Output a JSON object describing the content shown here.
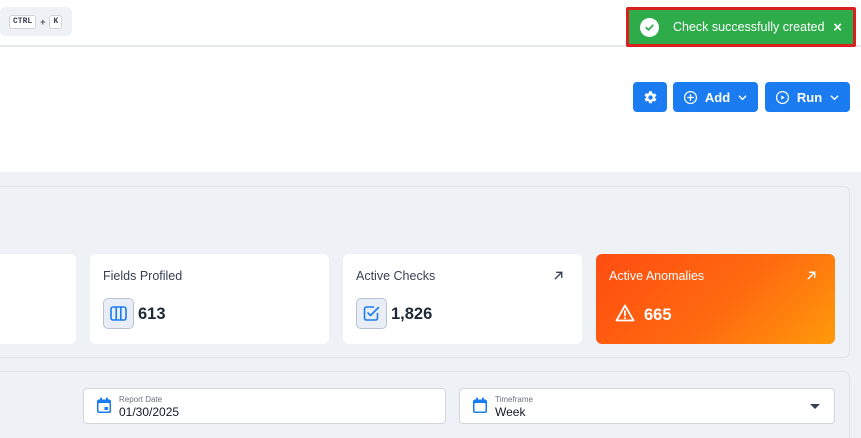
{
  "topbar": {
    "shortcut": {
      "key1": "CTRL",
      "plus": "+",
      "key2": "K"
    }
  },
  "toolbar": {
    "settings_icon": "gear-icon",
    "add_label": "Add",
    "run_label": "Run"
  },
  "summary": {
    "cards": [
      {
        "title": "Fields Profiled",
        "value": "613",
        "icon": "columns-icon"
      },
      {
        "title": "Active Checks",
        "value": "1,826",
        "icon": "check-square-icon",
        "link_icon": "arrow-up-right-icon"
      },
      {
        "title": "Active Anomalies",
        "value": "665",
        "icon": "warning-icon",
        "link_icon": "arrow-up-right-icon"
      }
    ]
  },
  "filters": {
    "report_date": {
      "label": "Report Date",
      "value": "01/30/2025",
      "icon": "calendar-icon"
    },
    "timeframe": {
      "label": "Timeframe",
      "value": "Week",
      "icon": "calendar-icon"
    }
  },
  "toast": {
    "message": "Check successfully created",
    "close": "×",
    "icon": "check-circle-icon"
  },
  "colors": {
    "primary": "#1a7cf0",
    "success": "#2eac4a",
    "anomaly_gradient_start": "#ff4d12",
    "anomaly_gradient_end": "#ff9a0a",
    "highlight_border": "#d9201f"
  }
}
